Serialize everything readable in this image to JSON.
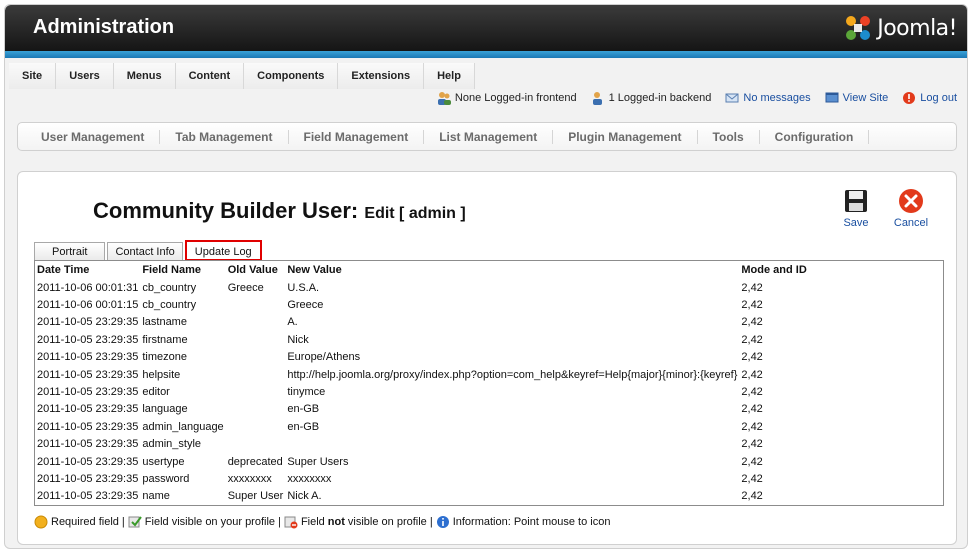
{
  "header": {
    "title": "Administration",
    "brand": "Joomla!"
  },
  "menu": [
    "Site",
    "Users",
    "Menus",
    "Content",
    "Components",
    "Extensions",
    "Help"
  ],
  "status": {
    "frontend": "None Logged-in frontend",
    "backend": "1 Logged-in backend",
    "messages": "No messages",
    "view_site": "View Site",
    "logout": "Log out"
  },
  "subtoolbar": [
    "User Management",
    "Tab Management",
    "Field Management",
    "List Management",
    "Plugin Management",
    "Tools",
    "Configuration"
  ],
  "page": {
    "title": "Community Builder User:",
    "subtitle": "Edit [ admin ]",
    "save_label": "Save",
    "cancel_label": "Cancel"
  },
  "tabs": [
    "Portrait",
    "Contact Info",
    "Update Log"
  ],
  "active_tab": "Update Log",
  "table": {
    "headers": [
      "Date Time",
      "Field Name",
      "Old Value",
      "New Value",
      "Mode and ID"
    ],
    "rows": [
      [
        "2011-10-06 00:01:31",
        "cb_country",
        "Greece",
        "U.S.A.",
        "2,42"
      ],
      [
        "2011-10-06 00:01:15",
        "cb_country",
        "",
        "Greece",
        "2,42"
      ],
      [
        "2011-10-05 23:29:35",
        "lastname",
        "",
        "A.",
        "2,42"
      ],
      [
        "2011-10-05 23:29:35",
        "firstname",
        "",
        "Nick",
        "2,42"
      ],
      [
        "2011-10-05 23:29:35",
        "timezone",
        "",
        "Europe/Athens",
        "2,42"
      ],
      [
        "2011-10-05 23:29:35",
        "helpsite",
        "",
        "http://help.joomla.org/proxy/index.php?option=com_help&keyref=Help{major}{minor}:{keyref}",
        "2,42"
      ],
      [
        "2011-10-05 23:29:35",
        "editor",
        "",
        "tinymce",
        "2,42"
      ],
      [
        "2011-10-05 23:29:35",
        "language",
        "",
        "en-GB",
        "2,42"
      ],
      [
        "2011-10-05 23:29:35",
        "admin_language",
        "",
        "en-GB",
        "2,42"
      ],
      [
        "2011-10-05 23:29:35",
        "admin_style",
        "",
        "",
        "2,42"
      ],
      [
        "2011-10-05 23:29:35",
        "usertype",
        "deprecated",
        "Super Users",
        "2,42"
      ],
      [
        "2011-10-05 23:29:35",
        "password",
        "xxxxxxxx",
        "xxxxxxxx",
        "2,42"
      ],
      [
        "2011-10-05 23:29:35",
        "name",
        "Super User",
        "Nick A.",
        "2,42"
      ]
    ]
  },
  "legend": {
    "required": "Required field |",
    "visible": "Field visible on your profile |",
    "not_visible_pre": "Field",
    "not_visible_bold": "not",
    "not_visible_post": "visible on profile |",
    "info": "Information: Point mouse to icon"
  },
  "colors": {
    "accent": "#1b78b5",
    "highlight": "#e00000",
    "link": "#1a4fa0"
  },
  "icons": [
    "joomla-logo-icon",
    "users-icon",
    "user-icon",
    "messages-icon",
    "view-site-icon",
    "logout-icon",
    "save-icon",
    "cancel-icon",
    "required-icon",
    "visible-icon",
    "not-visible-icon",
    "info-icon"
  ]
}
